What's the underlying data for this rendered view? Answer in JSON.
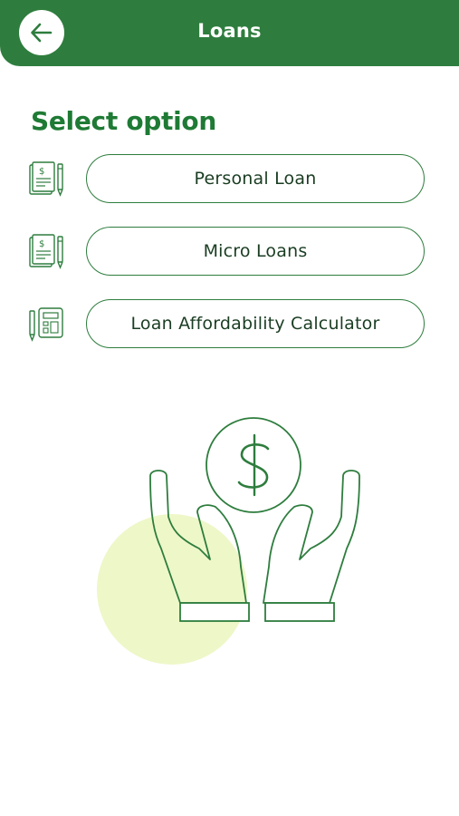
{
  "header": {
    "title": "Loans",
    "back_icon": "arrow-left-icon"
  },
  "main": {
    "section_title": "Select option",
    "options": [
      {
        "label": "Personal Loan",
        "icon": "document-pen-icon"
      },
      {
        "label": "Micro Loans",
        "icon": "document-pen-icon"
      },
      {
        "label": "Loan Affordability Calculator",
        "icon": "calculator-pen-icon"
      }
    ],
    "illustration_icon": "hands-dollar-icon"
  },
  "colors": {
    "primary": "#2e7d3e",
    "title_text": "#1e7a34",
    "button_text": "#1a3d22",
    "highlight": "#eef7c8"
  }
}
